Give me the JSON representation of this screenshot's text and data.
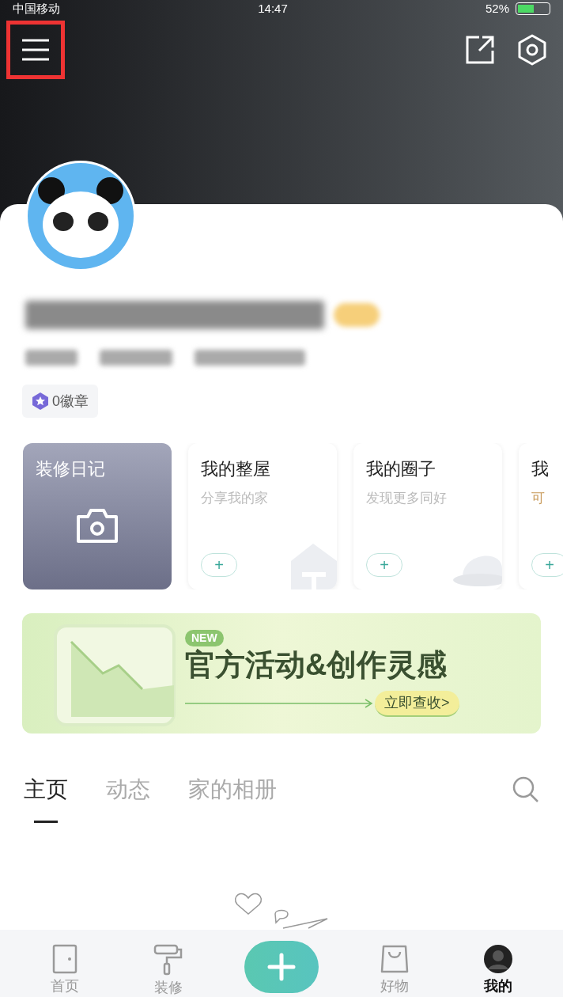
{
  "status_bar": {
    "carrier": "中国移动",
    "time": "14:47",
    "battery": "52%"
  },
  "header": {
    "menu_highlighted": true
  },
  "profile": {
    "badges": "0徽章"
  },
  "cards": [
    {
      "kind": "diary",
      "title": "装修日记"
    },
    {
      "kind": "entry",
      "title": "我的整屋",
      "subtitle": "分享我的家",
      "plus": "+",
      "accent": false
    },
    {
      "kind": "entry",
      "title": "我的圈子",
      "subtitle": "发现更多同好",
      "plus": "+",
      "accent": false
    },
    {
      "kind": "entry",
      "title": "我",
      "subtitle": "可",
      "plus": "+",
      "accent": true
    }
  ],
  "banner": {
    "tag": "NEW",
    "title": "官方活动&创作灵感",
    "button": "立即查收>"
  },
  "tabs": [
    {
      "label": "主页",
      "selected": true
    },
    {
      "label": "动态",
      "selected": false
    },
    {
      "label": "家的相册",
      "selected": false
    }
  ],
  "bottom_nav": [
    {
      "kind": "home",
      "label": "首页",
      "selected": false
    },
    {
      "kind": "roller",
      "label": "装修",
      "selected": false
    },
    {
      "kind": "add"
    },
    {
      "kind": "bag",
      "label": "好物",
      "selected": false
    },
    {
      "kind": "me",
      "label": "我的",
      "selected": true
    }
  ]
}
